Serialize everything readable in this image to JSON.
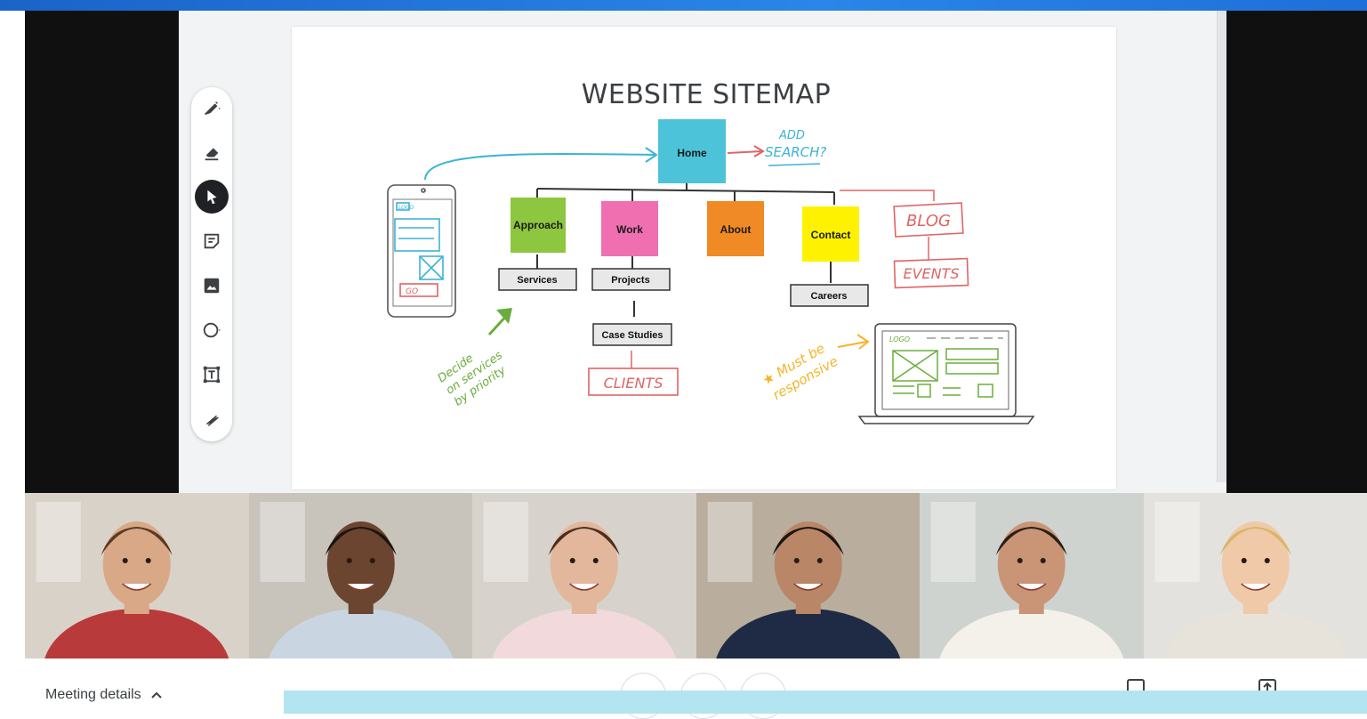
{
  "slide": {
    "title": "WEBSITE SITEMAP",
    "nodes": {
      "home": "Home",
      "approach": "Approach",
      "work": "Work",
      "about": "About",
      "contact": "Contact",
      "services": "Services",
      "projects": "Projects",
      "case_studies": "Case Studies",
      "careers": "Careers"
    },
    "handwriting": {
      "add_search_line1": "ADD",
      "add_search_line2": "SEARCH?",
      "blog": "BLOG",
      "events": "EVENTS",
      "clients": "CLIENTS",
      "decide_line1": "Decide",
      "decide_line2": "on services",
      "decide_line3": "by priority",
      "must_line1": "Must be",
      "must_line2": "responsive",
      "phone_logo": "LOGO",
      "phone_go": "GO",
      "laptop_logo": "LOGO"
    },
    "colors": {
      "home": "#4cc3d9",
      "approach": "#8dc63f",
      "work": "#f06fb0",
      "about": "#f08a24",
      "contact": "#fff200",
      "blue_ink": "#3bb4d6",
      "red_ink": "#e06464",
      "green_ink": "#6aad3c",
      "orange_ink": "#f5b428"
    }
  },
  "toolbar": {
    "tools": [
      {
        "name": "pen",
        "icon": "pen-icon"
      },
      {
        "name": "eraser",
        "icon": "eraser-icon"
      },
      {
        "name": "select",
        "icon": "select-arrow-icon",
        "active": true
      },
      {
        "name": "sticky-note",
        "icon": "sticky-note-icon"
      },
      {
        "name": "image",
        "icon": "image-icon"
      },
      {
        "name": "shape",
        "icon": "circle-icon"
      },
      {
        "name": "text-box",
        "icon": "text-box-icon"
      },
      {
        "name": "laser",
        "icon": "laser-icon"
      }
    ]
  },
  "participants": [
    {
      "id": "p1",
      "shirt": "#b83a3a"
    },
    {
      "id": "p2",
      "shirt": "#c9d6e2"
    },
    {
      "id": "p3",
      "shirt": "#f2d9dc"
    },
    {
      "id": "p4",
      "shirt": "#1f2a44"
    },
    {
      "id": "p5",
      "shirt": "#f4f1ea"
    },
    {
      "id": "p6",
      "shirt": "#e8e3da"
    }
  ],
  "footer": {
    "meeting_details_label": "Meeting details"
  }
}
